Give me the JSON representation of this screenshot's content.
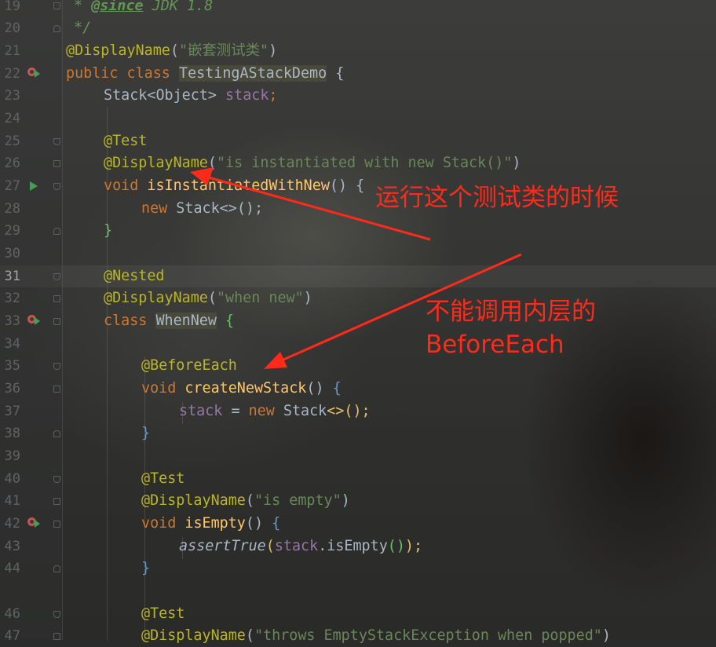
{
  "editor": {
    "current_line": "31",
    "line_numbers": [
      "19",
      "20",
      "21",
      "22",
      "23",
      "24",
      "25",
      "26",
      "27",
      "28",
      "29",
      "30",
      "31",
      "32",
      "33",
      "34",
      "35",
      "36",
      "37",
      "38",
      "39",
      "40",
      "41",
      "42",
      "43",
      "44",
      "46",
      "47"
    ]
  },
  "code": {
    "l19": [
      "* ",
      "@since",
      " JDK 1.8"
    ],
    "l20": [
      "*/"
    ],
    "l21": [
      "@DisplayName",
      "(",
      "\"嵌套测试类\"",
      ")"
    ],
    "l22": [
      "public ",
      "class ",
      "TestingAStackDemo",
      " {"
    ],
    "l23": [
      "Stack",
      "<",
      "Object",
      "> ",
      "stack",
      ";"
    ],
    "l25": [
      "@Test"
    ],
    "l26": [
      "@DisplayName",
      "(",
      "\"is instantiated with new Stack()\"",
      ")"
    ],
    "l27": [
      "void ",
      "isInstantiatedWithNew",
      "() {"
    ],
    "l28": [
      "new ",
      "Stack",
      "<>();"
    ],
    "l29": [
      "}"
    ],
    "l31": [
      "@Nested"
    ],
    "l32": [
      "@DisplayName",
      "(",
      "\"when new\"",
      ")"
    ],
    "l33": [
      "class ",
      "WhenNew",
      " {"
    ],
    "l35": [
      "@BeforeEach"
    ],
    "l36": [
      "void ",
      "createNewStack",
      "() ",
      "{"
    ],
    "l37": [
      "stack",
      " = ",
      "new ",
      "Stack",
      "<>();"
    ],
    "l38": [
      "}"
    ],
    "l40": [
      "@Test"
    ],
    "l41": [
      "@DisplayName",
      "(",
      "\"is empty\"",
      ")"
    ],
    "l42": [
      "void ",
      "isEmpty",
      "() ",
      "{"
    ],
    "l43": [
      "assertTrue",
      "(",
      "stack",
      ".isEmpty",
      "()",
      ");"
    ],
    "l44": [
      "}"
    ],
    "l46": [
      "@Test"
    ],
    "l47": [
      "@DisplayName",
      "(",
      "\"throws EmptyStackException when popped\"",
      ")"
    ]
  },
  "annotations": {
    "note1": "运行这个测试类的时候",
    "note2_line1": "不能调用内层的",
    "note2_line2": "BeforeEach",
    "color": "#ff2a1a"
  },
  "colors": {
    "keyword": "#cc7832",
    "annotation": "#bbb529",
    "string": "#6a8759",
    "field": "#9876aa",
    "method": "#ffc66d",
    "comment": "#629755",
    "text": "#a9b7c6"
  }
}
